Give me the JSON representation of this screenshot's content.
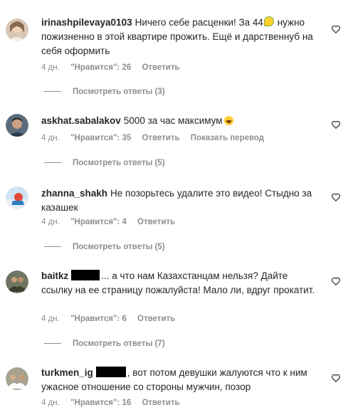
{
  "comments": [
    {
      "username": "irinashpilevaya0103",
      "text_a": "Ничего себе расценки! За 44",
      "emoji": "lemon-emoji",
      "text_b": " нужно пожизненно в этой квартире прожить. Ещё и дарственнуб на себя оформить",
      "age": "4 дн.",
      "likes": "\"Нравится\": 26",
      "reply": "Ответить",
      "view_replies": "Посмотреть ответы (3)"
    },
    {
      "username": "askhat.sabalakov",
      "text_a": "5000 за час максимум",
      "emoji": "laughing-emoji",
      "text_b": "",
      "age": "4 дн.",
      "likes": "\"Нравится\": 35",
      "reply": "Ответить",
      "translate": "Показать перевод",
      "view_replies": "Посмотреть ответы (5)"
    },
    {
      "username": "zhanna_shakh",
      "text_a": "Не позорьтесь удалите это видео! Стыдно за казашек",
      "age": "4 дн.",
      "likes": "\"Нравится\": 4",
      "reply": "Ответить",
      "view_replies": "Посмотреть ответы (5)"
    },
    {
      "username": "baitkz",
      "text_a": "... а что нам Казахстанцам нельзя? Дайте ссылку на ее страницу пожалуйста! Мало ли, вдруг прокатит.",
      "age": "4 дн.",
      "likes": "\"Нравится\": 6",
      "reply": "Ответить",
      "view_replies": "Посмотреть ответы (7)"
    },
    {
      "username": "turkmen_ig",
      "text_a": ", вот потом девушки жалуются что к ним ужасное отношение со стороны мужчин, позор",
      "age": "4 дн.",
      "likes": "\"Нравится\": 16",
      "reply": "Ответить"
    }
  ]
}
